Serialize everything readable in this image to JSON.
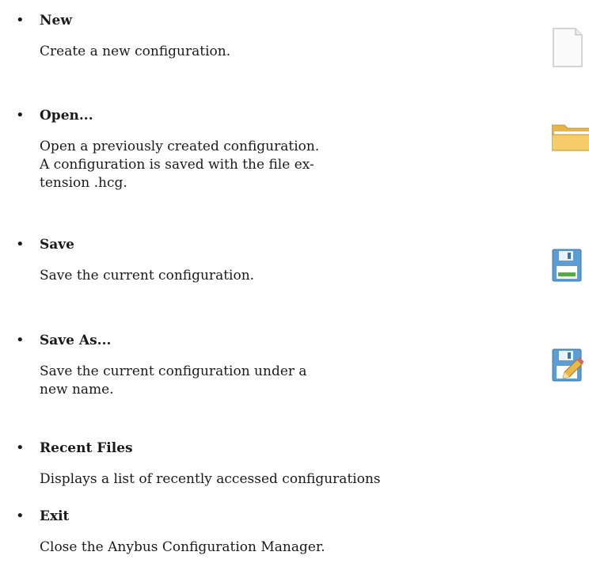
{
  "menu_items": [
    {
      "title": "New",
      "description_lines": [
        "Create a new configuration."
      ],
      "icon": "new-file-icon"
    },
    {
      "title": "Open...",
      "description_lines": [
        "Open a previously created configuration.",
        "A configuration is saved with the file ex-",
        "tension .hcg."
      ],
      "icon": "open-folder-icon"
    },
    {
      "title": "Save",
      "description_lines": [
        "Save the current configuration."
      ],
      "icon": "save-disk-icon"
    },
    {
      "title": "Save As...",
      "description_lines": [
        "Save the current configuration under a",
        "new name."
      ],
      "icon": "save-as-disk-icon"
    },
    {
      "title": "Recent Files",
      "description_lines": [
        "Displays a list of recently accessed configurations"
      ]
    },
    {
      "title": "Exit",
      "description_lines": [
        "Close the Anybus Configuration Manager."
      ]
    }
  ],
  "bullet_char": "•"
}
